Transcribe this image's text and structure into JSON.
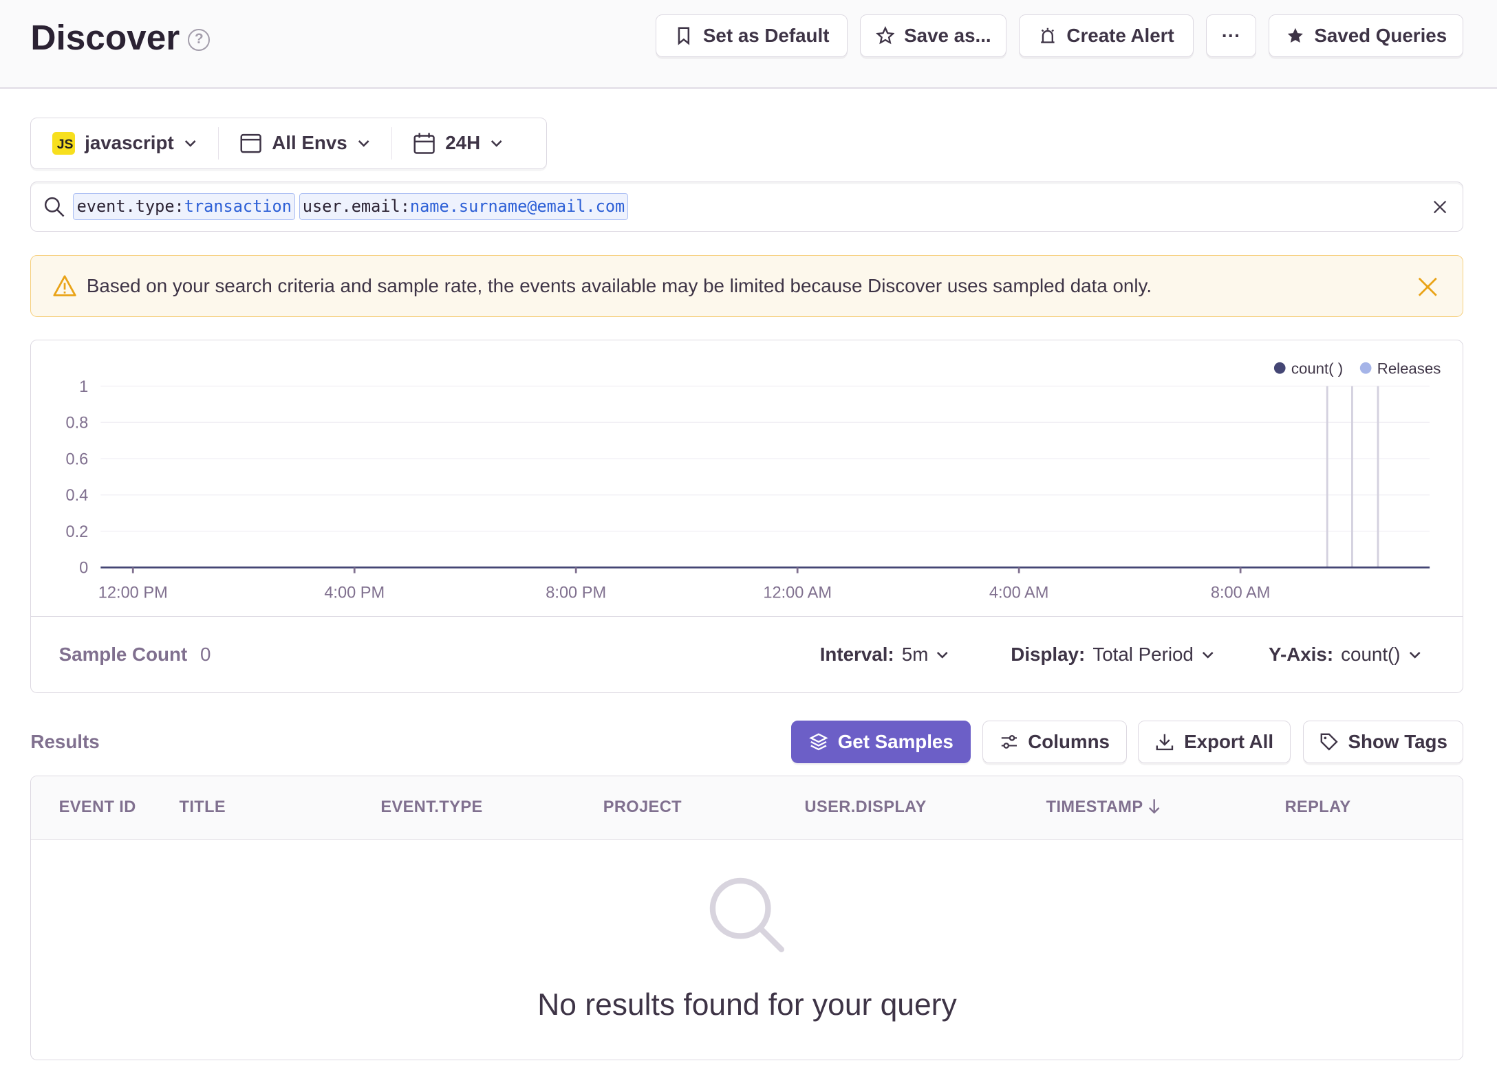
{
  "header": {
    "title": "Discover",
    "buttons": {
      "set_default": "Set as Default",
      "save_as": "Save as...",
      "create_alert": "Create Alert",
      "more": "···",
      "saved_queries": "Saved Queries"
    }
  },
  "filters": {
    "project": "javascript",
    "project_badge": "JS",
    "environment": "All Envs",
    "period": "24H"
  },
  "search": {
    "tokens": [
      {
        "key": "event.type:",
        "value": "transaction"
      },
      {
        "key": "user.email:",
        "value": "name.surname@email.com"
      }
    ]
  },
  "alert": {
    "message": "Based on your search criteria and sample rate, the events available may be limited because Discover uses sampled data only."
  },
  "chart_data": {
    "type": "line",
    "legend": [
      "count( )",
      "Releases"
    ],
    "legend_placement": "top-right",
    "series": [
      {
        "name": "count( )",
        "values": [
          0,
          0
        ],
        "x": [
          "11:25 AM",
          "11:25 AM (+1d)"
        ]
      }
    ],
    "releases": [
      "9:34 AM",
      "10:01 AM",
      "10:29 AM"
    ],
    "yticks": [
      "1",
      "0.8",
      "0.6",
      "0.4",
      "0.2",
      "0"
    ],
    "ylim": [
      0,
      1
    ],
    "xticks": [
      "12:00 PM",
      "4:00 PM",
      "8:00 PM",
      "12:00 AM",
      "4:00 AM",
      "8:00 AM"
    ],
    "grid": true,
    "colors": {
      "count": "#444674",
      "releases": "#a5b4e8"
    }
  },
  "chart_footer": {
    "sample_count_label": "Sample Count",
    "sample_count": "0",
    "interval_label": "Interval:",
    "interval": "5m",
    "display_label": "Display:",
    "display": "Total Period",
    "yaxis_label": "Y-Axis:",
    "yaxis": "count()"
  },
  "results": {
    "label": "Results",
    "get_samples": "Get Samples",
    "columns": "Columns",
    "export_all": "Export All",
    "show_tags": "Show Tags"
  },
  "table": {
    "columns": [
      "EVENT ID",
      "TITLE",
      "EVENT.TYPE",
      "PROJECT",
      "USER.DISPLAY",
      "TIMESTAMP",
      "REPLAY"
    ],
    "sort_column": "TIMESTAMP",
    "empty": "No results found for your query"
  },
  "colors": {
    "accent": "#6c5fc7",
    "warning": "#f6cf7d"
  }
}
